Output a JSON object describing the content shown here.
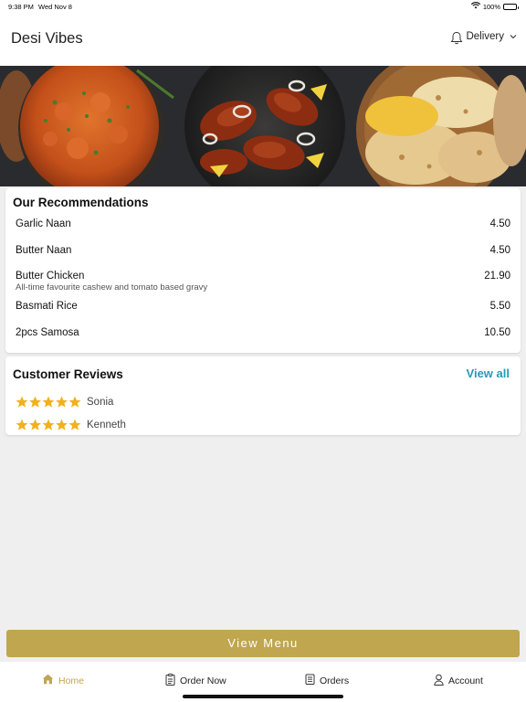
{
  "status": {
    "time": "9:38 PM",
    "date": "Wed Nov 8",
    "battery": "100%"
  },
  "header": {
    "title": "Desi Vibes",
    "delivery_label": "Delivery"
  },
  "recommendations": {
    "title": "Our Recommendations",
    "items": [
      {
        "name": "Garlic Naan",
        "price": "4.50",
        "description": ""
      },
      {
        "name": "Butter Naan",
        "price": "4.50",
        "description": ""
      },
      {
        "name": "Butter Chicken",
        "price": "21.90",
        "description": "All-time favourite cashew and tomato based gravy"
      },
      {
        "name": "Basmati Rice",
        "price": "5.50",
        "description": ""
      },
      {
        "name": "2pcs Samosa",
        "price": "10.50",
        "description": ""
      }
    ]
  },
  "reviews": {
    "title": "Customer Reviews",
    "view_all": "View all",
    "items": [
      {
        "name": "Sonia",
        "rating": 5
      },
      {
        "name": "Kenneth",
        "rating": 5
      }
    ]
  },
  "view_menu_label": "View Menu",
  "tabs": [
    {
      "label": "Home",
      "icon": "home-icon",
      "active": true
    },
    {
      "label": "Order Now",
      "icon": "clipboard-icon",
      "active": false
    },
    {
      "label": "Orders",
      "icon": "receipt-icon",
      "active": false
    },
    {
      "label": "Account",
      "icon": "person-icon",
      "active": false
    }
  ],
  "colors": {
    "accent": "#bfa64f",
    "link": "#2a98b8",
    "star": "#f2b01e"
  }
}
